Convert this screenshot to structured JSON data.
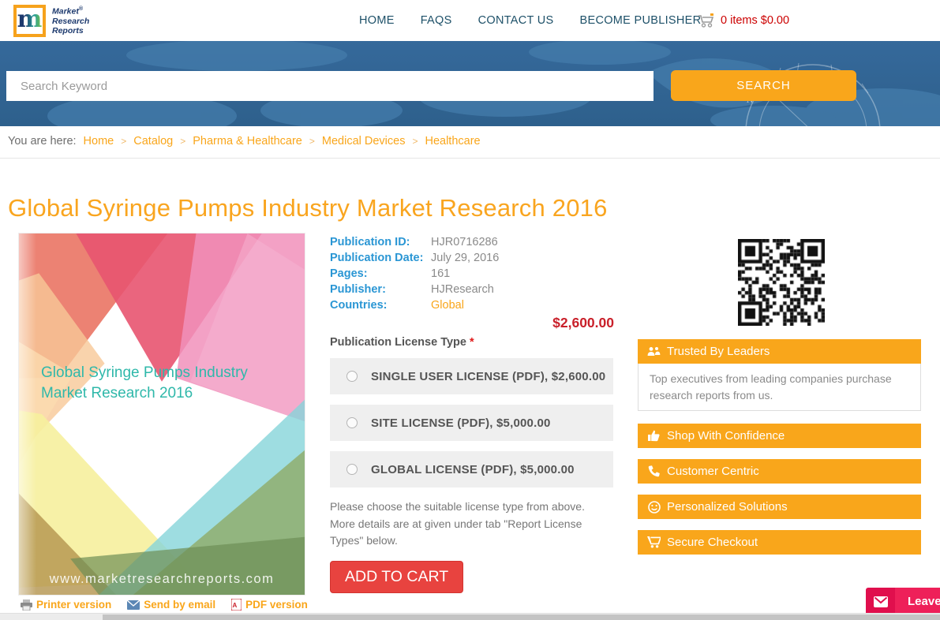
{
  "header": {
    "logo": {
      "letter": "m",
      "line1": "Market",
      "reg": "®",
      "line2": "Research",
      "line3": "Reports"
    },
    "nav": [
      "HOME",
      "FAQS",
      "CONTACT US",
      "BECOME PUBLISHER"
    ],
    "cart_text": "0 items $0.00"
  },
  "banner": {
    "search_placeholder": "Search Keyword",
    "search_button": "SEARCH"
  },
  "breadcrumb": {
    "prefix": "You are here:",
    "separator": ">",
    "items": [
      "Home",
      "Catalog",
      "Pharma & Healthcare",
      "Medical Devices",
      "Healthcare"
    ]
  },
  "page": {
    "title": "Global Syringe Pumps Industry Market Research 2016"
  },
  "cover": {
    "title_line1": "Global Syringe Pumps Industry",
    "title_line2": "Market Research 2016",
    "website": "www.marketresearchreports.com"
  },
  "details": {
    "rows": [
      {
        "label": "Publication ID:",
        "value": "HJR0716286"
      },
      {
        "label": "Publication Date:",
        "value": "July 29, 2016"
      },
      {
        "label": "Pages:",
        "value": "161"
      },
      {
        "label": "Publisher:",
        "value": "HJResearch"
      },
      {
        "label": "Countries:",
        "value": "Global"
      }
    ],
    "price": "$2,600.00"
  },
  "license": {
    "heading": "Publication License Type ",
    "required_mark": "*",
    "options": [
      "SINGLE USER LICENSE (PDF), $2,600.00",
      "SITE LICENSE (PDF), $5,000.00",
      "GLOBAL LICENSE (PDF), $5,000.00"
    ],
    "note": "Please choose the suitable license type from above. More details are at given under tab \"Report License Types\" below.",
    "add_to_cart": "ADD TO CART"
  },
  "sidebar": {
    "boxes": [
      {
        "label": "Trusted By Leaders",
        "icon": "users-icon",
        "description": "Top executives from leading companies purchase research reports from us."
      },
      {
        "label": "Shop With Confidence",
        "icon": "thumbs-up-icon"
      },
      {
        "label": "Customer Centric",
        "icon": "phone-icon"
      },
      {
        "label": "Personalized Solutions",
        "icon": "smiley-icon"
      },
      {
        "label": "Secure Checkout",
        "icon": "cart-icon"
      }
    ]
  },
  "footer_links": [
    {
      "label": "Printer version",
      "icon": "printer-icon"
    },
    {
      "label": "Send by email",
      "icon": "email-icon"
    },
    {
      "label": "PDF version",
      "icon": "pdf-icon"
    }
  ],
  "chat": {
    "label": "Leave"
  },
  "colors": {
    "accent_orange": "#f9a61b",
    "title_orange": "#f9a51f",
    "nav_navy": "#1d5068",
    "label_blue": "#2a96d4",
    "price_red": "#c9202a",
    "cart_red": "#cc0000",
    "button_red": "#e8433f",
    "banner_blue": "#35699b",
    "cover_teal": "#2fb8aa",
    "chat_pink": "#ee2059"
  }
}
